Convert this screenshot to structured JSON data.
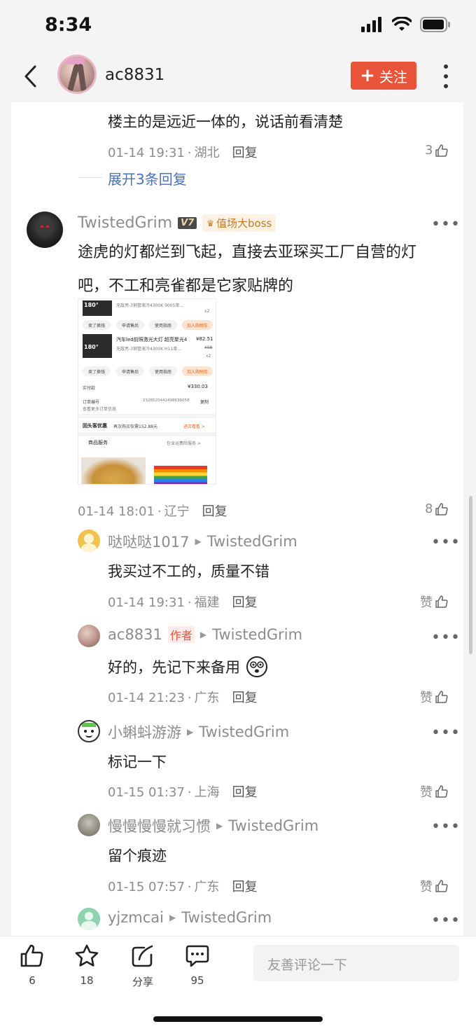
{
  "status_bar": {
    "time": "8:34"
  },
  "header": {
    "username": "ac8831",
    "follow_label": "关注"
  },
  "prev_reply": {
    "text": "楼主的是远近一体的，说话前看清楚",
    "date": "01-14 19:31",
    "location": "湖北",
    "reply_label": "回复",
    "likes": "3"
  },
  "expand_label": "展开3条回复",
  "comment": {
    "username": "TwistedGrim",
    "level": "V7",
    "badge": "值场大boss",
    "text_line1": "途虎的灯都烂到飞起，直接去亚琛买工厂自营的灯",
    "text_line2": "吧，不工和亮雀都是它家贴牌的",
    "date": "01-14 18:01",
    "location": "辽宁",
    "reply_label": "回复",
    "likes": "8"
  },
  "receipt": {
    "item1_desc": "无敌亮-3铜管液冷4300K 9005单...",
    "item1_qty": "x2",
    "item2_title": "汽车led前照激光大灯 超亮聚光4",
    "item2_price": "¥82.51",
    "item2_desc": "无敌亮-3铜管液冷4300K H11单...",
    "item2_old": "¥98",
    "item2_qty": "x2",
    "btn_sell": "卖了换钱",
    "btn_after": "申请售后",
    "btn_guide": "使用指南",
    "btn_cart": "加入购物车",
    "paid_label": "实付款",
    "paid_value": "¥330.03",
    "order_label": "订单编号",
    "order_no": "2328520442498636058",
    "copy_label": "复制",
    "more_info": "查看更多订单信息",
    "promo_title": "回头客优惠",
    "promo_text": "再次购买仅需152.88元",
    "promo_link": "进店看看 >",
    "service_label": "商品服务",
    "service_right": "包含运费险服务 >",
    "thumb_badge": "180°"
  },
  "replies": [
    {
      "username": "哒哒哒1017",
      "to": "TwistedGrim",
      "text": "我买过不工的，质量不错",
      "date": "01-14 19:31",
      "location": "福建",
      "reply_label": "回复",
      "likes": "赞"
    },
    {
      "username": "ac8831",
      "author_tag": "作者",
      "to": "TwistedGrim",
      "text": "好的，先记下来备用",
      "date": "01-14 21:23",
      "location": "广东",
      "reply_label": "回复",
      "likes": "赞"
    },
    {
      "username": "小蝌蚪游游",
      "to": "TwistedGrim",
      "text": "标记一下",
      "date": "01-15 01:37",
      "location": "上海",
      "reply_label": "回复",
      "likes": "赞"
    },
    {
      "username": "慢慢慢慢就习惯",
      "to": "TwistedGrim",
      "text": "留个痕迹",
      "date": "01-15 07:57",
      "location": "广东",
      "reply_label": "回复",
      "likes": "赞"
    },
    {
      "username": "yjzmcai",
      "to": "TwistedGrim"
    }
  ],
  "bottom_bar": {
    "like_count": "6",
    "fav_count": "18",
    "share_label": "分享",
    "comment_count": "95",
    "input_placeholder": "友善评论一下"
  },
  "colors": {
    "accent": "#e8533a",
    "link": "#4a73b8",
    "badge_bg": "#fdf1e4"
  }
}
